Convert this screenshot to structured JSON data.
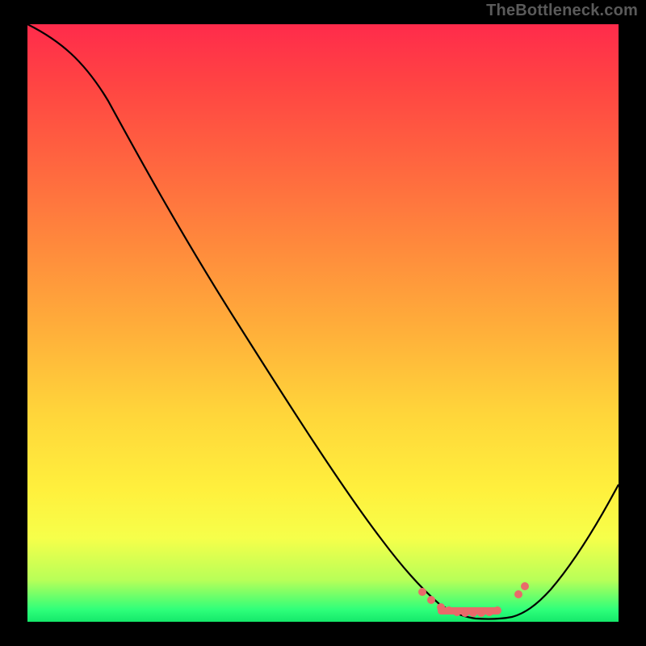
{
  "watermark": "TheBottleneck.com",
  "colors": {
    "background": "#000000",
    "watermark": "#5a5a5a",
    "curve": "#000000",
    "dots": "#e86a6a",
    "gradient_top": "#ff2b4b",
    "gradient_bottom": "#14e86a"
  },
  "chart_data": {
    "type": "line",
    "title": "",
    "xlabel": "",
    "ylabel": "",
    "xlim": [
      0,
      100
    ],
    "ylim": [
      0,
      100
    ],
    "series": [
      {
        "name": "bottleneck-curve",
        "x": [
          0,
          3,
          8,
          14,
          22,
          30,
          38,
          46,
          54,
          60,
          64,
          67,
          70,
          72,
          74,
          76,
          78,
          80,
          82,
          84,
          86,
          88,
          90,
          94,
          98,
          100
        ],
        "values": [
          100,
          99,
          96,
          90,
          80,
          70,
          60,
          50,
          40,
          31,
          24,
          18,
          12,
          8,
          5,
          3,
          2,
          1.5,
          1,
          1,
          2,
          4,
          7,
          14,
          22,
          26
        ]
      }
    ],
    "markers": {
      "name": "highlight-dots",
      "x": [
        67,
        70,
        71,
        72,
        73,
        74,
        75,
        76,
        77,
        78,
        79,
        80,
        81,
        82,
        83,
        84,
        85,
        86
      ],
      "values": [
        6.5,
        4.5,
        4,
        3.5,
        3.2,
        3,
        2.9,
        2.8,
        2.7,
        2.6,
        2.5,
        2.5,
        2.6,
        2.8,
        3.2,
        4,
        6.5,
        7.5
      ]
    }
  }
}
